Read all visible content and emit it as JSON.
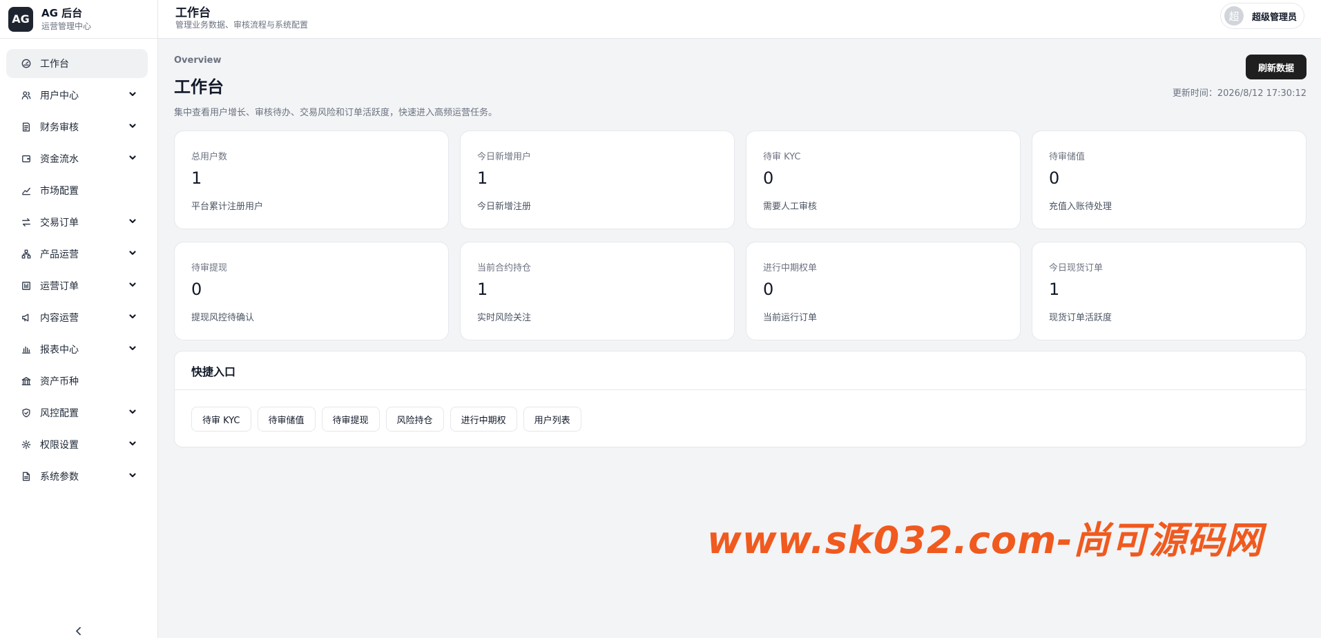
{
  "brand": {
    "logo": "AG",
    "title": "AG 后台",
    "subtitle": "运营管理中心"
  },
  "sidebar": {
    "items": [
      {
        "label": "工作台",
        "icon": "gauge-icon",
        "active": true,
        "expandable": false
      },
      {
        "label": "用户中心",
        "icon": "users-icon",
        "active": false,
        "expandable": true
      },
      {
        "label": "财务审核",
        "icon": "receipt-icon",
        "active": false,
        "expandable": true
      },
      {
        "label": "资金流水",
        "icon": "wallet-icon",
        "active": false,
        "expandable": true
      },
      {
        "label": "市场配置",
        "icon": "line-chart-icon",
        "active": false,
        "expandable": false
      },
      {
        "label": "交易订单",
        "icon": "swap-icon",
        "active": false,
        "expandable": true
      },
      {
        "label": "产品运营",
        "icon": "network-icon",
        "active": false,
        "expandable": true
      },
      {
        "label": "运营订单",
        "icon": "order-board-icon",
        "active": false,
        "expandable": true
      },
      {
        "label": "内容运营",
        "icon": "megaphone-icon",
        "active": false,
        "expandable": true
      },
      {
        "label": "报表中心",
        "icon": "bar-chart-icon",
        "active": false,
        "expandable": true
      },
      {
        "label": "资产币种",
        "icon": "bank-icon",
        "active": false,
        "expandable": false
      },
      {
        "label": "风控配置",
        "icon": "shield-icon",
        "active": false,
        "expandable": true
      },
      {
        "label": "权限设置",
        "icon": "gear-icon",
        "active": false,
        "expandable": true
      },
      {
        "label": "系统参数",
        "icon": "document-icon",
        "active": false,
        "expandable": true
      }
    ]
  },
  "header": {
    "title": "工作台",
    "subtitle": "管理业务数据、审核流程与系统配置",
    "user": {
      "avatar_text": "超",
      "name": "超级管理员"
    }
  },
  "main": {
    "overview_label": "Overview",
    "title": "工作台",
    "description": "集中查看用户增长、审核待办、交易风险和订单活跃度，快速进入高频运营任务。",
    "refresh_label": "刷新数据",
    "updated_text": "更新时间：2026/8/12 17:30:12",
    "cards": [
      {
        "label": "总用户数",
        "value": "1",
        "note": "平台累计注册用户"
      },
      {
        "label": "今日新增用户",
        "value": "1",
        "note": "今日新增注册"
      },
      {
        "label": "待审 KYC",
        "value": "0",
        "note": "需要人工审核"
      },
      {
        "label": "待审储值",
        "value": "0",
        "note": "充值入账待处理"
      },
      {
        "label": "待审提现",
        "value": "0",
        "note": "提现风控待确认"
      },
      {
        "label": "当前合约持仓",
        "value": "1",
        "note": "实时风险关注"
      },
      {
        "label": "进行中期权单",
        "value": "0",
        "note": "当前运行订单"
      },
      {
        "label": "今日现货订单",
        "value": "1",
        "note": "现货订单活跃度"
      }
    ],
    "quick": {
      "title": "快捷入口",
      "buttons": [
        "待审 KYC",
        "待审储值",
        "待审提现",
        "风险持仓",
        "进行中期权",
        "用户列表"
      ]
    }
  },
  "watermark": "www.sk032.com-尚可源码网",
  "colors": {
    "accent_dark": "#1f1f1f",
    "watermark": "#f05a1f",
    "background": "#f3f4f6"
  }
}
